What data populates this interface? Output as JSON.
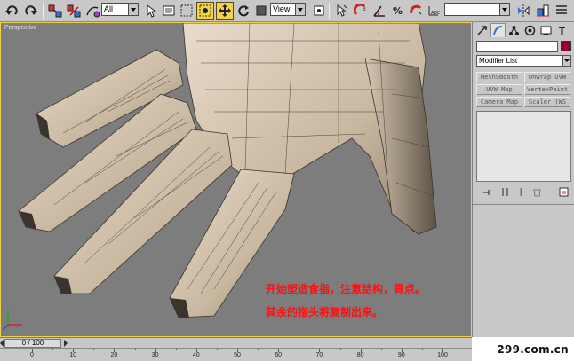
{
  "toolbar": {
    "filter_value": "All",
    "refcoord_value": "View",
    "named_selection_value": "",
    "icons": [
      "undo-icon",
      "redo-icon",
      "select-link-icon",
      "unlink-icon",
      "bind-space-warp-icon",
      "select-object-icon",
      "select-by-name-icon",
      "rect-selection-icon",
      "window-crossing-icon",
      "move-icon",
      "rotate-icon",
      "scale-icon",
      "pivot-icon",
      "select-manipulate-icon",
      "snap-3d-icon",
      "angle-snap-icon",
      "percent-snap-icon",
      "spinner-snap-icon",
      "named-selection-icon",
      "mirror-icon",
      "align-icon",
      "layer-icon",
      "curve-editor-icon"
    ]
  },
  "viewport": {
    "label": "Perspective",
    "caption_line1": "开始塑造食指，注意结构，骨点。",
    "caption_line2": "其余的指头将复制出来。",
    "caption_color": "#ff1010",
    "background": "#7d7d7d",
    "active_border_color": "#f0d34a"
  },
  "command_panel": {
    "tabs": [
      "create-tab",
      "modify-tab",
      "hierarchy-tab",
      "motion-tab",
      "display-tab",
      "utilities-tab"
    ],
    "object_name": "",
    "object_color": "#8f0035",
    "modifier_list": "Modifier List",
    "modifier_buttons": [
      "MeshSmooth",
      "Unwrap UVW",
      "UVW Map",
      "VertexPaint",
      "Camera Map",
      "Scaler (WS"
    ]
  },
  "time_slider": {
    "label": "0 / 100"
  },
  "track_bar": {
    "ticks": [
      "0",
      "10",
      "20",
      "30",
      "40",
      "50",
      "60",
      "70",
      "80",
      "90",
      "100"
    ]
  },
  "watermark": {
    "text": "299.com.cn"
  }
}
